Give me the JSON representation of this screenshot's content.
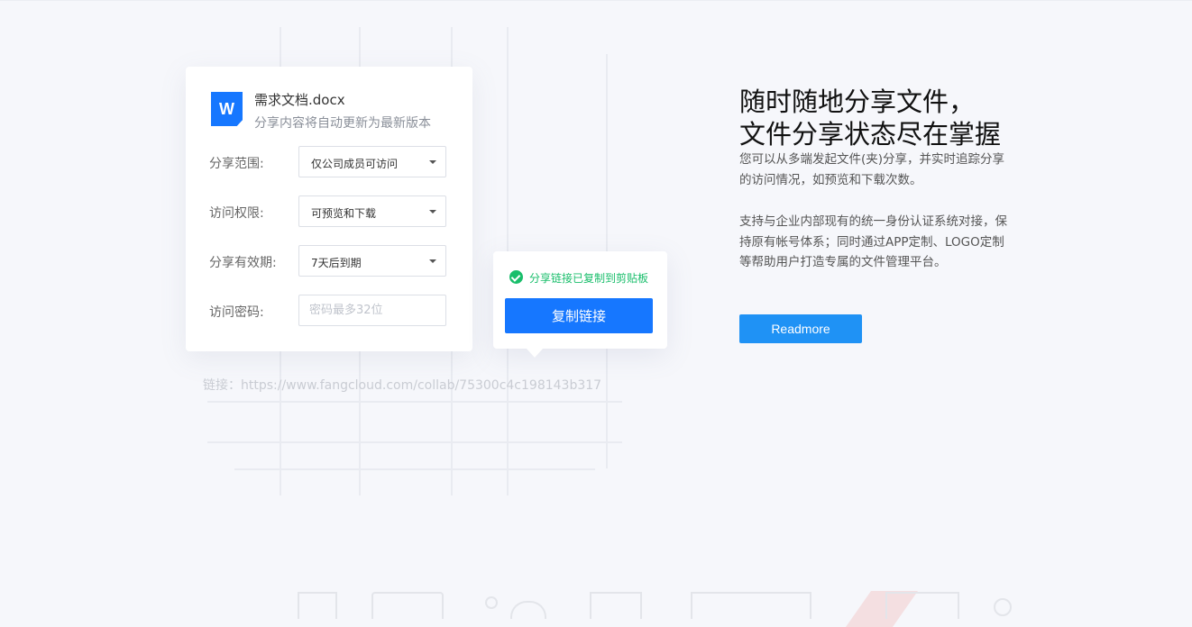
{
  "share_panel": {
    "doc_icon_letter": "W",
    "doc_name": "需求文档.docx",
    "doc_subtitle": "分享内容将自动更新为最新版本",
    "scope": {
      "label": "分享范围:",
      "value": "仅公司成员可访问"
    },
    "permission": {
      "label": "访问权限:",
      "value": "可预览和下载"
    },
    "validity": {
      "label": "分享有效期:",
      "value": "7天后到期"
    },
    "password": {
      "label": "访问密码:",
      "placeholder": "密码最多32位"
    }
  },
  "copy_popover": {
    "status_text": "分享链接已复制到剪贴板",
    "button_label": "复制链接"
  },
  "link_text": "链接：https://www.fangcloud.com/collab/75300c4c198143b317",
  "feature": {
    "headline_line1": "随时随地分享文件，",
    "headline_line2": "文件分享状态尽在掌握",
    "paragraph1": "您可以从多端发起文件(夹)分享，并实时追踪分享的访问情况，如预览和下载次数。",
    "paragraph2": "支持与企业内部现有的统一身份认证系统对接，保持原有帐号体系；同时通过APP定制、LOGO定制等帮助用户打造专属的文件管理平台。",
    "readmore_label": "Readmore"
  },
  "colors": {
    "primary": "#1677ff",
    "readmore": "#1f92f5",
    "success": "#19be6b",
    "background": "#f6f7fb"
  }
}
